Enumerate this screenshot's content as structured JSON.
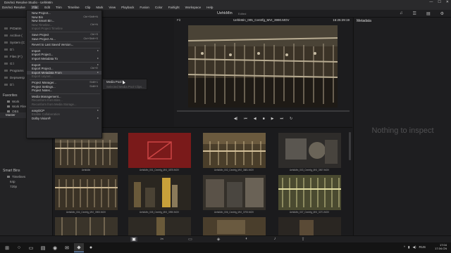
{
  "window": {
    "title": "DaVinci Resolve Studio - UehkMin",
    "controls": [
      "—",
      "☐",
      "✕"
    ]
  },
  "menubar": [
    "DaVinci Resolve",
    "File",
    "Edit",
    "Trim",
    "Timeline",
    "Clip",
    "Mark",
    "View",
    "Playback",
    "Fusion",
    "Color",
    "Fairlight",
    "Workspace",
    "Help"
  ],
  "toolbar": {
    "project_name": "UehkMin",
    "edited_label": "Edited"
  },
  "viewer": {
    "zoom": "Fit",
    "clip_name": "UehkMin_005_Centrfg_MVI_3990.MOV",
    "timecode": "16:25:29:19"
  },
  "metadata": {
    "title": "Metadata",
    "empty_text": "Nothing to inspect"
  },
  "left_panel": {
    "locations": [
      "PrDatIm",
      "Archive (",
      "System (C",
      "D:\\",
      "Files (F:)",
      "G:\\",
      "Programs",
      "Depswesp",
      "D:\\"
    ],
    "favorites_title": "Favorites",
    "favorites": [
      "Work",
      "Work Files",
      "OBS"
    ],
    "master_label": "Master",
    "smart_bins_title": "Smart Bins",
    "smart_bins": [
      "Timelines",
      "64p",
      "720p"
    ]
  },
  "file_menu": {
    "items": [
      {
        "label": "New Project...",
        "disabled": false
      },
      {
        "label": "New Bin",
        "shortcut": "Ctrl+Shift+N",
        "disabled": false
      },
      {
        "label": "New Smart Bin...",
        "disabled": false
      },
      {
        "label": "New Timeline...",
        "shortcut": "Ctrl+N",
        "disabled": true
      },
      {
        "label": "Import Project Timeline",
        "disabled": true
      },
      {
        "sep": true
      },
      {
        "label": "Save Project",
        "shortcut": "Ctrl+S",
        "disabled": false
      },
      {
        "label": "Save Project As...",
        "shortcut": "Ctrl+Shift+S",
        "disabled": false
      },
      {
        "sep": true
      },
      {
        "label": "Revert to Last Saved Version...",
        "disabled": false
      },
      {
        "sep": true
      },
      {
        "label": "Import",
        "arrow": true,
        "disabled": false
      },
      {
        "label": "Import Project...",
        "disabled": false
      },
      {
        "label": "Import Metadata To",
        "arrow": true,
        "disabled": false
      },
      {
        "sep": true
      },
      {
        "label": "Export",
        "arrow": true,
        "disabled": false
      },
      {
        "label": "Export Project...",
        "shortcut": "Ctrl+E",
        "disabled": false
      },
      {
        "label": "Export Metadata From",
        "arrow": true,
        "hover": true,
        "disabled": false
      },
      {
        "label": "Export Layout...",
        "disabled": true
      },
      {
        "sep": true
      },
      {
        "label": "Project Manager...",
        "shortcut": "Shift+1",
        "disabled": false
      },
      {
        "label": "Project Settings...",
        "shortcut": "Shift+9",
        "disabled": false
      },
      {
        "label": "Project Notes...",
        "disabled": false
      },
      {
        "sep": true
      },
      {
        "label": "Media Management...",
        "disabled": false
      },
      {
        "label": "Reconform from Bins...",
        "disabled": true
      },
      {
        "label": "Reconform from Media Storage...",
        "disabled": true
      },
      {
        "sep": true
      },
      {
        "label": "easyDCP",
        "arrow": true,
        "disabled": false
      },
      {
        "label": "Enable Collaboration",
        "disabled": true
      },
      {
        "label": "Dolby Vision®",
        "arrow": true,
        "disabled": false
      }
    ]
  },
  "submenu": {
    "items": [
      {
        "label": "Media Pool",
        "disabled": false
      },
      {
        "label": "Selected Media Pool Clips...",
        "disabled": true
      }
    ]
  },
  "media_pool": {
    "clips": [
      {
        "name": "UehkMin",
        "selected": false
      },
      {
        "name": "UehkMin_001_Centrfg_MVI_3875.MOV",
        "selected": true
      },
      {
        "name": "UehkMin_002_Centrfg_MVI_3881.MOV",
        "selected": false
      },
      {
        "name": "UehkMin_003_Centrfg_MVI_3907.MOV",
        "selected": false
      },
      {
        "name": "UehkMin_004_Centrfg_MVI_3900.MOV",
        "selected": false
      },
      {
        "name": "UehkMin_005_Centrfg_MVI_3990.MOV",
        "selected": false
      },
      {
        "name": "UehkMin_006_Centrfg_MVI_3793.MOV",
        "selected": false
      },
      {
        "name": "UehkMin_007_Centrfg_MVI_3271.MOV",
        "selected": false
      }
    ]
  },
  "taskbar": {
    "app_label": "DaVinci Resolve 17",
    "lang": "RUS",
    "time": "17:04",
    "date": "17.04.CN"
  },
  "colors": {
    "accent": "#6fa0e0",
    "selected_clip": "#7a1a1a"
  }
}
